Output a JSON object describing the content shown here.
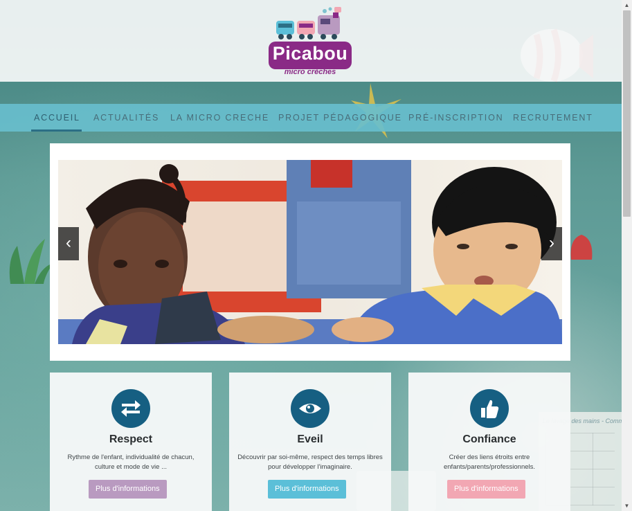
{
  "brand": {
    "name": "Picabou",
    "tagline": "micro crèches",
    "color": "#8a2a86"
  },
  "nav": {
    "items": [
      {
        "label": "ACCUEIL",
        "active": true
      },
      {
        "label": "ACTUALITÉS",
        "active": false
      },
      {
        "label": "LA MICRO CRECHE",
        "active": false
      },
      {
        "label": "PROJET PÉDAGOGIQUE",
        "active": false
      },
      {
        "label": "PRÉ-INSCRIPTION",
        "active": false
      },
      {
        "label": "RECRUTEMENT",
        "active": false
      }
    ],
    "background": "#68becd"
  },
  "slider": {
    "prev_icon": "chevron-left-icon",
    "next_icon": "chevron-right-icon",
    "prev_glyph": "‹",
    "next_glyph": "›"
  },
  "cards": [
    {
      "title": "Respect",
      "text": "Rythme de l'enfant, individualité de chacun, culture et mode de vie ...",
      "button": "Plus d'informations",
      "icon": "exchange-arrows-icon",
      "button_color": "#b99ac0"
    },
    {
      "title": "Eveil",
      "text": "Découvrir par soi-même, respect des temps libres pour développer l'imaginaire.",
      "button": "Plus d'informations",
      "icon": "eye-icon",
      "button_color": "#5bbfd8"
    },
    {
      "title": "Confiance",
      "text": "Créer des liens étroits entre enfants/parents/professionnels.",
      "button": "Plus d'informations",
      "icon": "thumbs-up-icon",
      "button_color": "#f2a7b3"
    }
  ],
  "background_poster": {
    "title": "Le lavage des mains - Comment"
  }
}
